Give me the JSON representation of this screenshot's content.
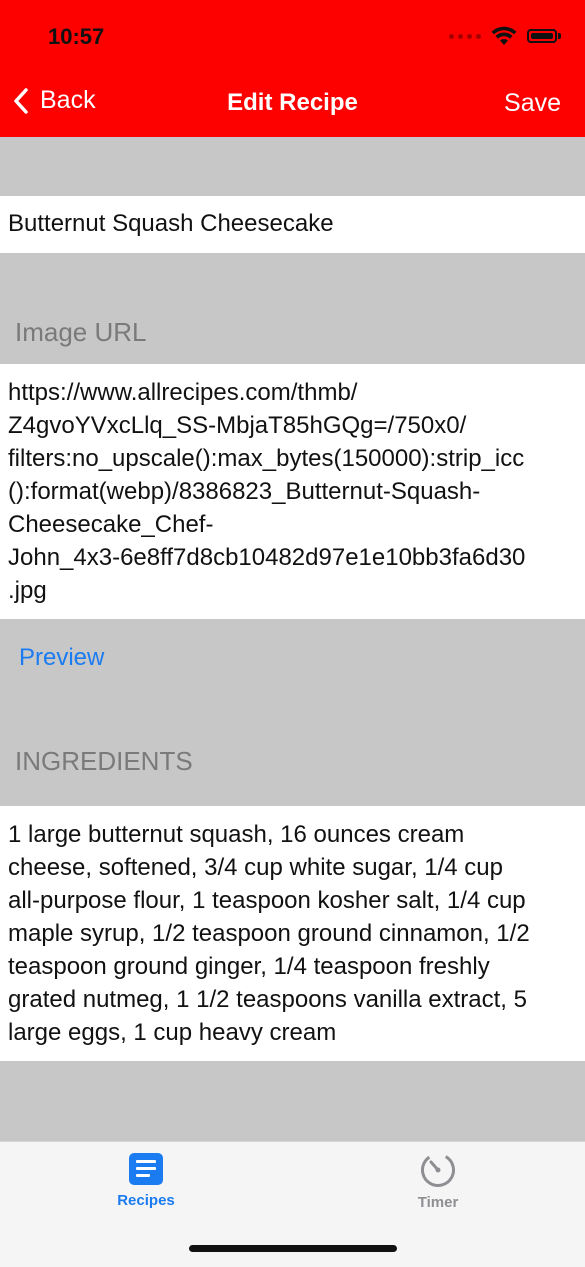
{
  "status": {
    "time": "10:57"
  },
  "nav": {
    "back": "Back",
    "title": "Edit Recipe",
    "save": "Save"
  },
  "recipe": {
    "name": "Butternut Squash Cheesecake",
    "image_url_label": "Image URL",
    "image_url_lines": [
      "https://www.allrecipes.com/thmb/",
      "Z4gvoYVxcLlq_SS-MbjaT85hGQg=/750x0/",
      "filters:no_upscale():max_bytes(150000):strip_icc",
      "():format(webp)/8386823_Butternut-Squash-",
      "Cheesecake_Chef-",
      "John_4x3-6e8ff7d8cb10482d97e1e10bb3fa6d30",
      ".jpg"
    ],
    "preview": "Preview",
    "ingredients_label": "INGREDIENTS",
    "ingredients_lines": [
      "1 large butternut squash, 16 ounces cream",
      "cheese, softened, 3/4 cup white sugar, 1/4 cup",
      "all-purpose flour, 1 teaspoon kosher salt, 1/4 cup",
      "maple syrup, 1/2 teaspoon ground cinnamon, 1/2",
      "teaspoon ground ginger, 1/4 teaspoon freshly",
      "grated nutmeg, 1 1/2 teaspoons vanilla extract, 5",
      "large eggs, 1 cup heavy cream"
    ]
  },
  "tabs": [
    {
      "label": "Recipes",
      "icon": "recipes-icon",
      "active": true
    },
    {
      "label": "Timer",
      "icon": "timer-icon",
      "active": false
    }
  ],
  "colors": {
    "accent": "#fd0000",
    "link": "#1a7cf0",
    "active_tab": "#1a7cf0",
    "inactive_tab": "#8e8e93"
  }
}
